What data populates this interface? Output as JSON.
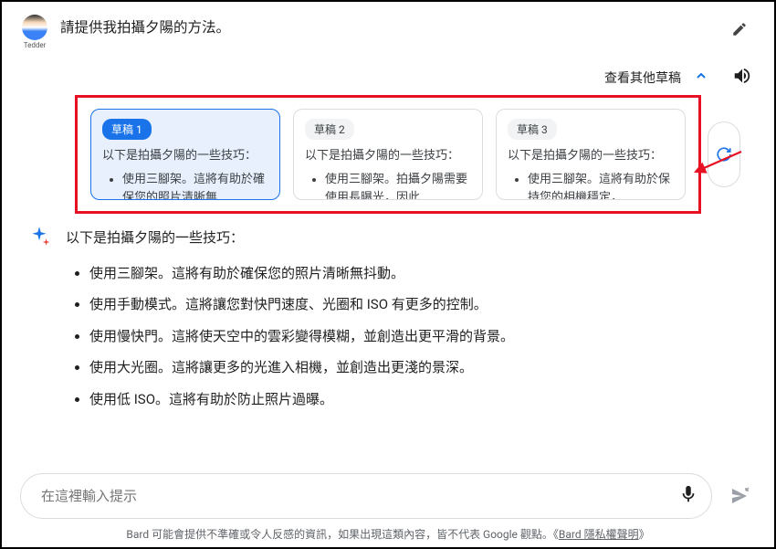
{
  "avatar_label": "Tedder",
  "prompt": "請提供我拍攝夕陽的方法。",
  "drafts_header": {
    "view_other": "查看其他草稿"
  },
  "drafts": [
    {
      "badge": "草稿 1",
      "preview_line": "以下是拍攝夕陽的一些技巧：",
      "preview_bullet": "使用三腳架。這將有助於確保您的照片清晰無"
    },
    {
      "badge": "草稿 2",
      "preview_line": "以下是拍攝夕陽的一些技巧：",
      "preview_bullet": "使用三腳架。拍攝夕陽需要使用長曝光，因此"
    },
    {
      "badge": "草稿 3",
      "preview_line": "以下是拍攝夕陽的一些技巧：",
      "preview_bullet": "使用三腳架。這將有助於保持您的相機穩定，"
    }
  ],
  "response": {
    "intro": "以下是拍攝夕陽的一些技巧：",
    "bullets": [
      "使用三腳架。這將有助於確保您的照片清晰無抖動。",
      "使用手動模式。這將讓您對快門速度、光圈和 ISO 有更多的控制。",
      "使用慢快門。這將使天空中的雲彩變得模糊，並創造出更平滑的背景。",
      "使用大光圈。這將讓更多的光進入相機，並創造出更淺的景深。",
      "使用低 ISO。這將有助於防止照片過曝。"
    ]
  },
  "input": {
    "placeholder": "在這裡輸入提示"
  },
  "disclaimer": {
    "text_before": "Bard 可能會提供不準確或令人反感的資訊，如果出現這類內容，皆不代表 Google 觀點。《",
    "link_text": "Bard 隱私權聲明",
    "text_after": "》"
  }
}
